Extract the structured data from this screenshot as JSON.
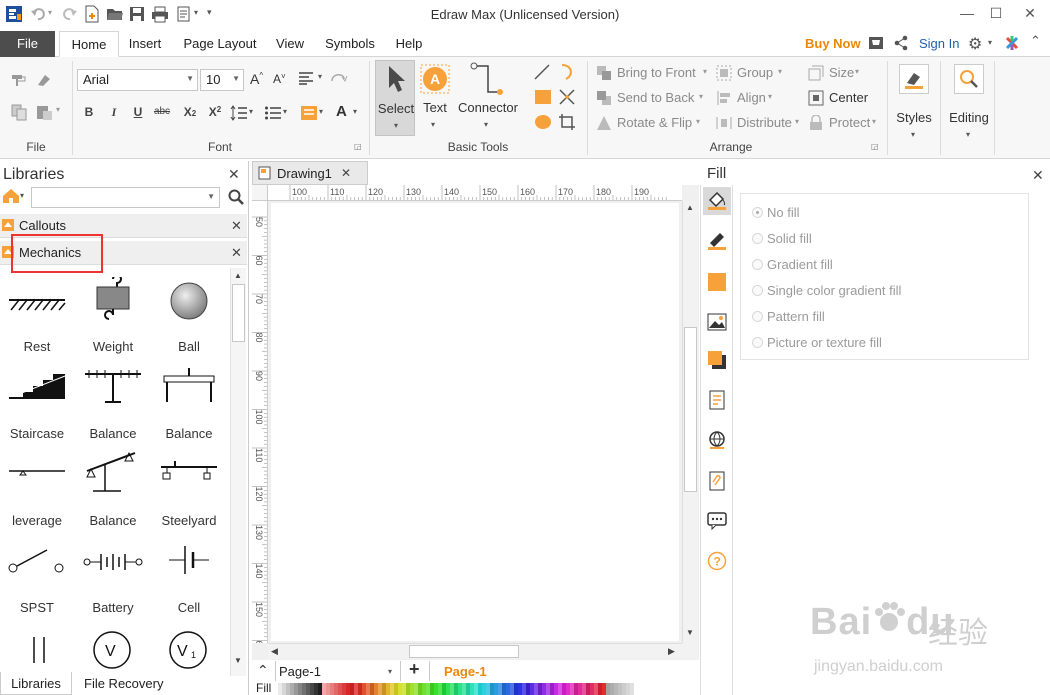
{
  "app": {
    "title": "Edraw Max (Unlicensed Version)"
  },
  "tabs": {
    "file": "File",
    "items": [
      "Home",
      "Insert",
      "Page Layout",
      "View",
      "Symbols",
      "Help"
    ],
    "active": "Home"
  },
  "header": {
    "buy_now": "Buy Now",
    "sign_in": "Sign In"
  },
  "ribbon": {
    "font": {
      "family": "Arial",
      "size": "10"
    },
    "groups": {
      "file": "File",
      "font": "Font",
      "basic_tools": "Basic Tools",
      "arrange": "Arrange"
    },
    "tools": {
      "select": "Select",
      "text": "Text",
      "connector": "Connector"
    },
    "arrange": {
      "bring_to_front": "Bring to Front",
      "send_to_back": "Send to Back",
      "rotate_flip": "Rotate & Flip",
      "group": "Group",
      "align": "Align",
      "distribute": "Distribute",
      "size": "Size",
      "center": "Center",
      "protect": "Protect"
    },
    "styles": "Styles",
    "editing": "Editing"
  },
  "libraries": {
    "title": "Libraries",
    "categories": [
      "Callouts",
      "Mechanics"
    ],
    "shapes": [
      "Rest",
      "Weight",
      "Ball",
      "Staircase",
      "Balance",
      "Balance",
      "leverage",
      "Balance",
      "Steelyard",
      "SPST",
      "Battery",
      "Cell"
    ],
    "bottom_tabs": [
      "Libraries",
      "File Recovery"
    ]
  },
  "document": {
    "tab": "Drawing1",
    "ruler_h": [
      "100",
      "110",
      "120",
      "130",
      "140",
      "150",
      "160",
      "170",
      "180",
      "190"
    ],
    "ruler_v": [
      "50",
      "60",
      "70",
      "80",
      "90",
      "100",
      "110",
      "120",
      "130",
      "140",
      "150",
      "60"
    ],
    "page_select": "Page-1",
    "page_tab": "Page-1",
    "fill_label": "Fill"
  },
  "fill_panel": {
    "title": "Fill",
    "options": [
      "No fill",
      "Solid fill",
      "Gradient fill",
      "Single color gradient fill",
      "Pattern fill",
      "Picture or texture fill"
    ]
  },
  "watermark": {
    "brand": "Bai",
    "brand2": "du",
    "cn": "经验",
    "url": "jingyan.baidu.com"
  },
  "colors": {
    "accent": "#e8890c",
    "file_tab": "#4d4d4d",
    "highlight": "#ee3333",
    "orange_icon": "#f7a13a",
    "link": "#1f5fb0"
  }
}
